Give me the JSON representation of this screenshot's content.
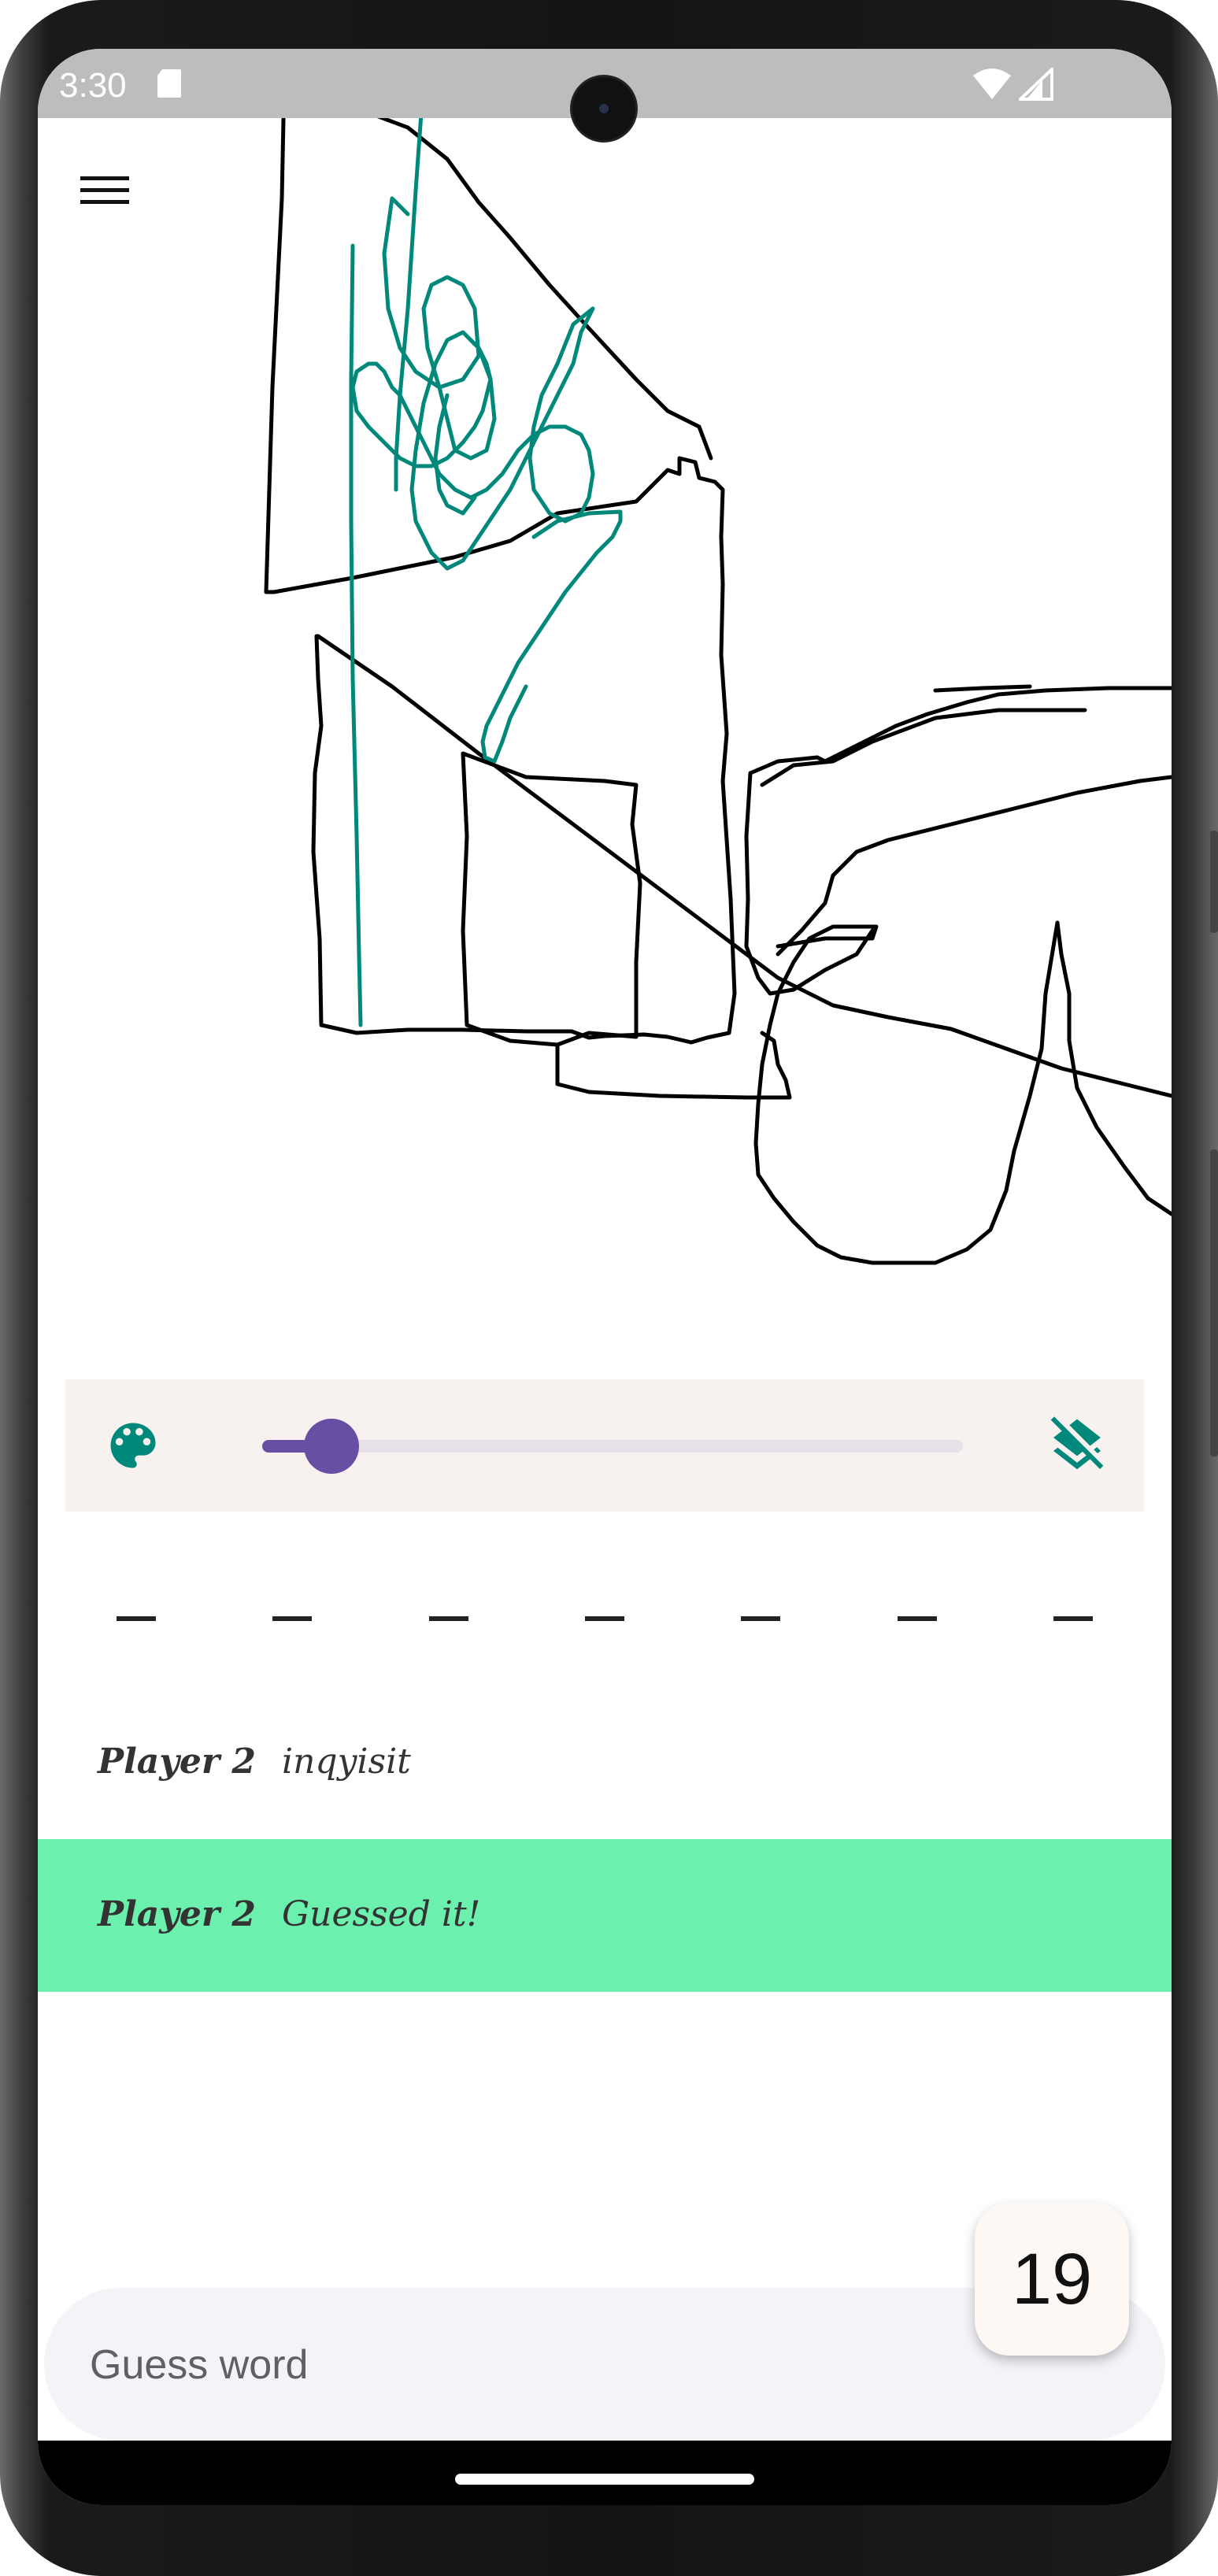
{
  "status_bar": {
    "time": "3:30"
  },
  "toolbar": {
    "brush_size_percent": 6,
    "brush_color": "#00897b"
  },
  "word_hint": {
    "blanks": [
      "_",
      "_",
      "_",
      "_",
      "_",
      "_",
      "_"
    ]
  },
  "messages": [
    {
      "player": "Player 2",
      "text": "inqyisit",
      "correct": false
    },
    {
      "player": "Player 2",
      "text": "Guessed it!",
      "correct": true
    }
  ],
  "guess_input": {
    "placeholder": "Guess word",
    "value": ""
  },
  "timer": {
    "seconds": "19"
  },
  "colors": {
    "accent": "#6750a4",
    "teal": "#00897b",
    "correct_highlight": "#6bf0ae",
    "stroke_black": "#000000"
  },
  "icons": {
    "menu": "menu-icon",
    "palette": "palette-icon",
    "clear": "layers-clear-icon"
  }
}
